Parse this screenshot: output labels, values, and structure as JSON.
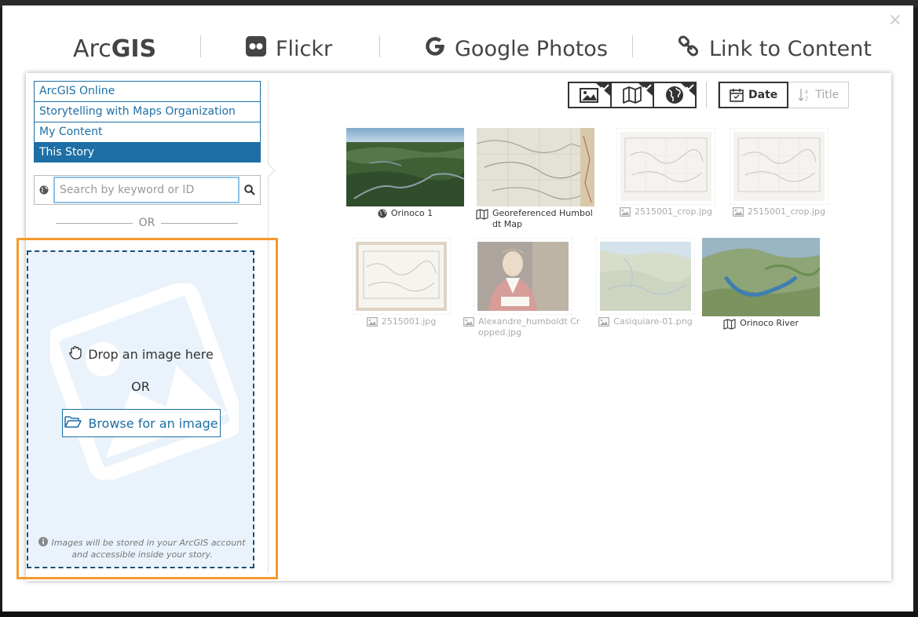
{
  "dialog": {
    "close_label": "×",
    "tabs": [
      {
        "label_light": "Arc",
        "label_bold": "GIS",
        "icon": "arcgis-logo"
      },
      {
        "label": "Flickr",
        "icon": "flickr-icon"
      },
      {
        "label": "Google Photos",
        "icon": "google-icon"
      },
      {
        "label": "Link to Content",
        "icon": "link-icon"
      }
    ]
  },
  "sidebar": {
    "sources": [
      {
        "label": "ArcGIS Online",
        "active": false
      },
      {
        "label": "Storytelling with Maps Organization",
        "active": false
      },
      {
        "label": "My Content",
        "active": false
      },
      {
        "label": "This Story",
        "active": true
      }
    ],
    "search_placeholder": "Search by keyword or ID",
    "or_label": "OR",
    "drop": {
      "title": "Drop an image here",
      "or_label": "OR",
      "browse_label": "Browse for an image",
      "note": "Images will be stored in your ArcGIS account and accessible inside your story."
    }
  },
  "toolbar": {
    "filters": [
      "image-filter-icon",
      "map-filter-icon",
      "scene-filter-icon"
    ],
    "sort": [
      {
        "label": "Date",
        "active": true
      },
      {
        "label": "Title",
        "active": false
      }
    ]
  },
  "items": [
    {
      "name": "Orinoco 1",
      "kind": "scene",
      "enabled": true
    },
    {
      "name": "Georeferenced Humboldt Map",
      "kind": "map",
      "enabled": true
    },
    {
      "name": "2515001_crop.jpg",
      "kind": "image",
      "enabled": false
    },
    {
      "name": "2515001_crop.jpg",
      "kind": "image",
      "enabled": false
    },
    {
      "name": "2515001.jpg",
      "kind": "image",
      "enabled": false
    },
    {
      "name": "Alexandre_humboldt Cropped.jpg",
      "kind": "image",
      "enabled": false
    },
    {
      "name": "Casiquiare-01.png",
      "kind": "image",
      "enabled": false
    },
    {
      "name": "Orinoco River",
      "kind": "map",
      "enabled": true
    }
  ],
  "colors": {
    "accent": "#1d6fa5",
    "highlight": "#f59a2c",
    "drop_bg": "#eaf3fb"
  }
}
